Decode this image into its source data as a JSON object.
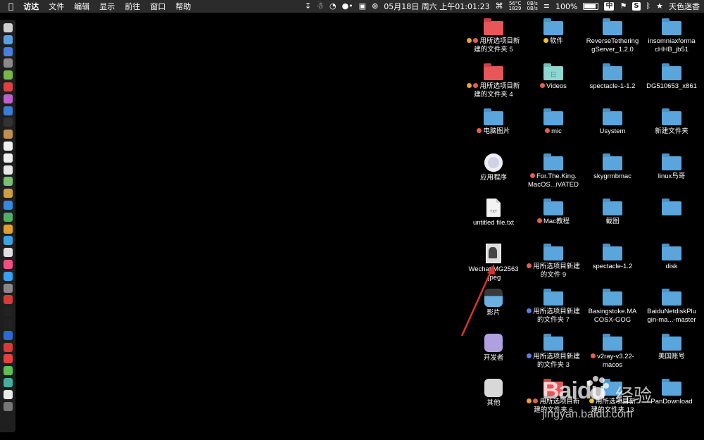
{
  "menubar": {
    "app_name": "访达",
    "menus": [
      "文件",
      "编辑",
      "显示",
      "前往",
      "窗口",
      "帮助"
    ],
    "temp_top": "56°C",
    "temp_bottom": "1829",
    "net_up": "0B/s",
    "net_down": "0B/s",
    "datetime": "05月18日 周六 上午01:01:23",
    "battery": "100%",
    "input_method": "中",
    "user": "天色迷香"
  },
  "desktop": {
    "items": [
      {
        "label": "用所选项目新\n建的文件夹 5",
        "kind": "folder-red",
        "tags": [
          "#f0a030",
          "#e06050"
        ]
      },
      {
        "label": "软件",
        "kind": "folder",
        "tags": [
          "#f0c030"
        ]
      },
      {
        "label": "ReverseTethering\ngServer_1.2.0",
        "kind": "folder",
        "tags": []
      },
      {
        "label": "insomniaxforma\ncHHB_jb51",
        "kind": "folder",
        "tags": []
      },
      {
        "label": "用所选项目新\n建的文件夹 4",
        "kind": "folder-red",
        "tags": [
          "#f0a030",
          "#e06050"
        ]
      },
      {
        "label": "Videos",
        "kind": "folder-teal",
        "tags": [
          "#e06050"
        ]
      },
      {
        "label": "spectacle-1-1.2",
        "kind": "folder",
        "tags": []
      },
      {
        "label": "DG510653_x861",
        "kind": "folder",
        "tags": []
      },
      {
        "label": "电脑图片",
        "kind": "folder",
        "tags": [
          "#e06050"
        ]
      },
      {
        "label": "mic",
        "kind": "folder",
        "tags": [
          "#e06050"
        ]
      },
      {
        "label": "Usystem",
        "kind": "folder",
        "tags": []
      },
      {
        "label": "新建文件夹",
        "kind": "folder",
        "tags": []
      },
      {
        "label": "应用程序",
        "kind": "app-applications",
        "tags": []
      },
      {
        "label": "For.The.King.\nMacOS...iVATED",
        "kind": "folder",
        "tags": [
          "#e06050"
        ]
      },
      {
        "label": "skygrmbmac",
        "kind": "folder",
        "tags": []
      },
      {
        "label": "linux鸟哥",
        "kind": "folder",
        "tags": []
      },
      {
        "label": "untitled file.txt",
        "kind": "doc",
        "tags": []
      },
      {
        "label": "Mac教程",
        "kind": "folder",
        "tags": [
          "#e06050"
        ]
      },
      {
        "label": "截图",
        "kind": "folder",
        "tags": []
      },
      {
        "label": "",
        "kind": "folder",
        "tags": []
      },
      {
        "label": "WechatIMG2563\n.jpeg",
        "kind": "photo",
        "tags": []
      },
      {
        "label": "用所选项目新建\n的文件 9",
        "kind": "folder",
        "tags": [
          "#e06050"
        ]
      },
      {
        "label": "spectacle-1.2",
        "kind": "folder",
        "tags": []
      },
      {
        "label": "disk",
        "kind": "folder",
        "tags": []
      },
      {
        "label": "影片",
        "kind": "app-movies",
        "tags": []
      },
      {
        "label": "用所选项目新建\n的文件夹 7",
        "kind": "folder",
        "tags": [
          "#5a7ee8"
        ]
      },
      {
        "label": "Basingstoke.MA\nCOSX-GOG",
        "kind": "folder",
        "tags": []
      },
      {
        "label": "BaiduNetdiskPlu\ngin-ma...-master",
        "kind": "folder",
        "tags": []
      },
      {
        "label": "开发者",
        "kind": "app-developer",
        "tags": []
      },
      {
        "label": "用所选项目新建\n的文件夹 3",
        "kind": "folder",
        "tags": [
          "#5a7ee8"
        ]
      },
      {
        "label": "v2ray-v3.22-\nmacos",
        "kind": "folder",
        "tags": [
          "#e06050"
        ]
      },
      {
        "label": "美国账号",
        "kind": "folder",
        "tags": []
      },
      {
        "label": "其他",
        "kind": "app-other",
        "tags": []
      },
      {
        "label": "用所选项目新\n建的文件夹 6",
        "kind": "folder-red",
        "tags": [
          "#f0a030",
          "#e06050"
        ]
      },
      {
        "label": "用所选项目新\n建的文件夹 13",
        "kind": "folder",
        "tags": [
          "#f0c030"
        ]
      },
      {
        "label": "PanDownload",
        "kind": "folder",
        "tags": []
      }
    ]
  },
  "watermark": {
    "brand": "Baidu",
    "product": "经验",
    "url": "jingyan.baidu.com"
  },
  "colors": {
    "menubar_bg": "#2b2b2b",
    "folder_blue": "#5aa6dc",
    "arrow_red": "#d9362b"
  }
}
